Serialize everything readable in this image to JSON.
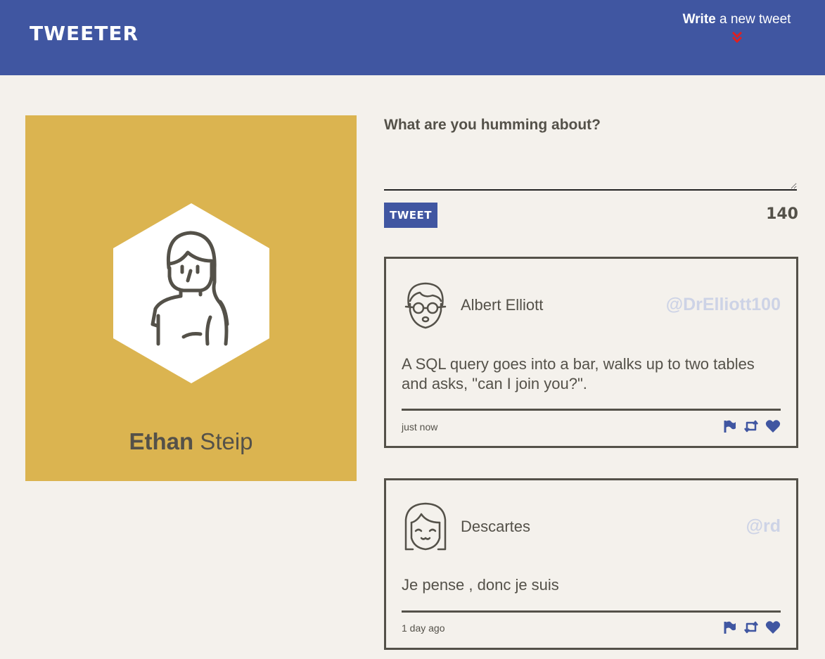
{
  "nav": {
    "brand": "TWEETER",
    "compose_bold": "Write",
    "compose_rest": " a new tweet",
    "toggle_icon": "double-chevron-down-icon",
    "toggle_color": "#e02020"
  },
  "profile": {
    "first_name": "Ethan",
    "last_name": " Steip",
    "avatar_icon": "woman-avatar-icon",
    "card_color": "#dbb450"
  },
  "compose": {
    "label": "What are you humming about?",
    "textarea_value": "",
    "button_label": "TWEET",
    "counter": "140"
  },
  "tweets": [
    {
      "name": "Albert Elliott",
      "handle": "@DrElliott100",
      "avatar_icon": "man-glasses-avatar-icon",
      "text": "A SQL query goes into a bar, walks up to two tables and asks, \"can I join you?\".",
      "time": "just now"
    },
    {
      "name": "Descartes",
      "handle": "@rd",
      "avatar_icon": "girl-bangs-avatar-icon",
      "text": "Je pense , donc je suis",
      "time": "1 day ago"
    }
  ],
  "colors": {
    "nav_bg": "#4056a1",
    "page_bg": "#f4f1ec",
    "text": "#545149",
    "handle": "#cdd3e6",
    "accent": "#4056a1"
  },
  "action_icons": [
    "flag-icon",
    "retweet-icon",
    "heart-icon"
  ]
}
